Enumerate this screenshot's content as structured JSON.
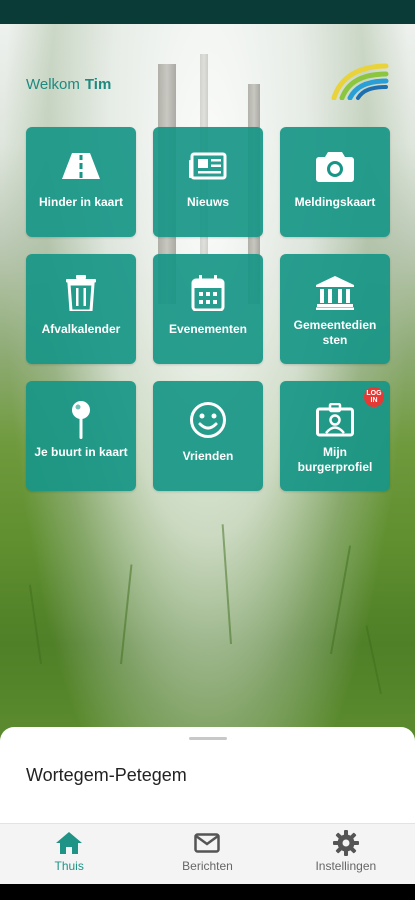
{
  "header": {
    "welcome": "Welkom",
    "user_name": "Tim"
  },
  "tiles": [
    {
      "label": "Hinder in kaart",
      "icon": "road-icon"
    },
    {
      "label": "Nieuws",
      "icon": "newspaper-icon"
    },
    {
      "label": "Meldingskaart",
      "icon": "camera-icon"
    },
    {
      "label": "Afvalkalender",
      "icon": "trash-icon"
    },
    {
      "label": "Evenementen",
      "icon": "calendar-icon"
    },
    {
      "label": "Gemeentedien sten",
      "icon": "municipal-building-icon"
    },
    {
      "label": "Je buurt in kaart",
      "icon": "map-pin-icon"
    },
    {
      "label": "Vrienden",
      "icon": "smiley-icon"
    },
    {
      "label": "Mijn burgerprofiel",
      "icon": "profile-card-icon",
      "badge": "LOG IN"
    }
  ],
  "sheet": {
    "municipality": "Wortegem-Petegem"
  },
  "bottom_nav": [
    {
      "label": "Thuis",
      "icon": "home-icon",
      "active": true
    },
    {
      "label": "Berichten",
      "icon": "mail-icon",
      "active": false
    },
    {
      "label": "Instellingen",
      "icon": "gear-icon",
      "active": false
    }
  ],
  "colors": {
    "accent": "#1f9486",
    "tile": "#179687",
    "status_bar": "#0b3b36",
    "badge": "#e53935"
  }
}
